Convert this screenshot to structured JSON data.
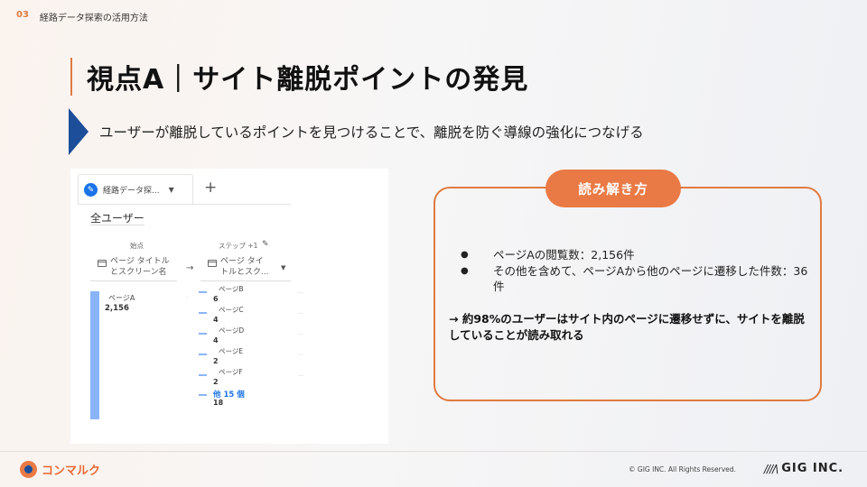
{
  "header": {
    "number": "03",
    "section": "経路データ探索の活用方法"
  },
  "title": "視点A｜サイト離脱ポイントの発見",
  "subtitle": "ユーザーが離脱しているポイントを見つけることで、離脱を防ぐ導線の強化につなげる",
  "screenshot": {
    "tab_label": "経路データ探...",
    "segment": "全ユーザー",
    "col_start": "始点",
    "col_step": "ステップ +1",
    "dim_start": [
      "ページ タイトル",
      "とスクリーン名"
    ],
    "dim_step": [
      "ページ タイ",
      "トルとスク..."
    ],
    "start_node": {
      "label": "ページA",
      "value": "2,156"
    },
    "steps": [
      {
        "label": "ページB",
        "value": "6"
      },
      {
        "label": "ページC",
        "value": "4"
      },
      {
        "label": "ページD",
        "value": "4"
      },
      {
        "label": "ページE",
        "value": "2"
      },
      {
        "label": "ページF",
        "value": "2"
      }
    ],
    "more": {
      "label": "他 15 個",
      "value": "18"
    }
  },
  "card": {
    "heading": "読み解き方",
    "bullets": [
      "ページAの閲覧数：2,156件",
      "その他を含めて、ページAから他のページに遷移した件数：36件"
    ],
    "conclusion": "→ 約98%のユーザーはサイト内のページに遷移せずに、サイトを離脱していることが読み取れる"
  },
  "footer": {
    "logo_text": "コンマルク",
    "copyright": "© GIG INC. All Rights Reserved.",
    "company": "GIG INC."
  },
  "colors": {
    "accent": "#e07a40",
    "navy": "#1c4e9a",
    "link": "#1a73e8",
    "bar": "#8ab4f8"
  }
}
